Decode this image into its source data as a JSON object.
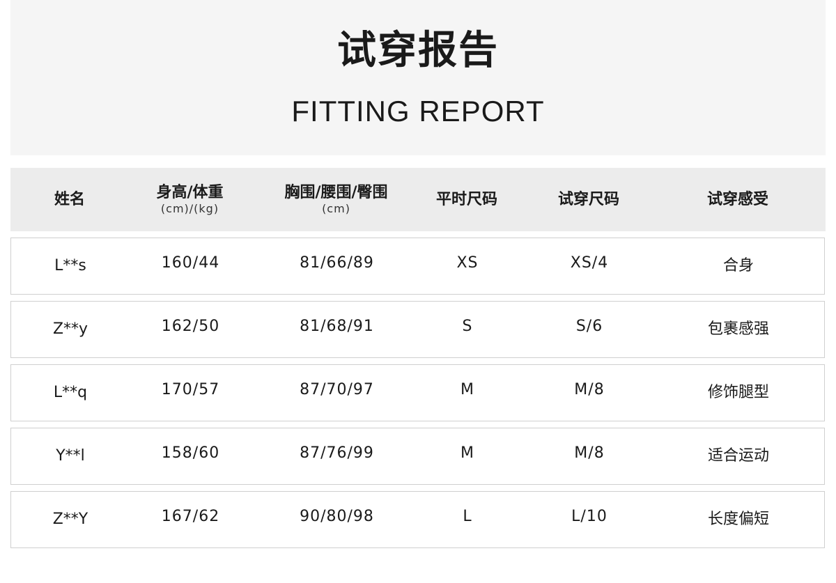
{
  "header": {
    "title_cn": "试穿报告",
    "title_en": "FITTING REPORT"
  },
  "table": {
    "columns": [
      {
        "label": "姓名",
        "sub": ""
      },
      {
        "label": "身高/体重",
        "sub": "(cm)/(kg)"
      },
      {
        "label": "胸围/腰围/臀围",
        "sub": "(cm)"
      },
      {
        "label": "平时尺码",
        "sub": ""
      },
      {
        "label": "试穿尺码",
        "sub": ""
      },
      {
        "label": "试穿感受",
        "sub": ""
      }
    ],
    "rows": [
      {
        "name": "L**s",
        "height_weight": "160/44",
        "measurements": "81/66/89",
        "usual_size": "XS",
        "fitting_size": "XS/4",
        "feeling": "合身"
      },
      {
        "name": "Z**y",
        "height_weight": "162/50",
        "measurements": "81/68/91",
        "usual_size": "S",
        "fitting_size": "S/6",
        "feeling": "包裹感强"
      },
      {
        "name": "L**q",
        "height_weight": "170/57",
        "measurements": "87/70/97",
        "usual_size": "M",
        "fitting_size": "M/8",
        "feeling": "修饰腿型"
      },
      {
        "name": "Y**l",
        "height_weight": "158/60",
        "measurements": "87/76/99",
        "usual_size": "M",
        "fitting_size": "M/8",
        "feeling": "适合运动"
      },
      {
        "name": "Z**Y",
        "height_weight": "167/62",
        "measurements": "90/80/98",
        "usual_size": "L",
        "fitting_size": "L/10",
        "feeling": "长度偏短"
      }
    ]
  }
}
